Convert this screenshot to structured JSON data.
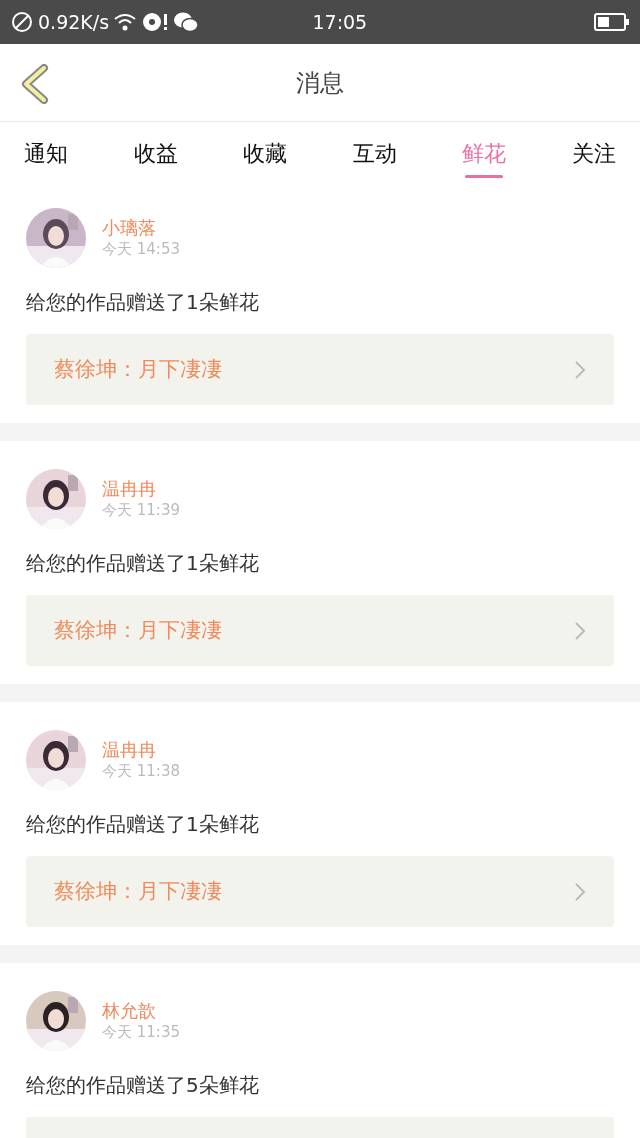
{
  "status_bar": {
    "net_speed": "0.92K/s",
    "time": "17:05"
  },
  "header": {
    "title": "消息"
  },
  "tabs": [
    {
      "label": "通知",
      "selected": false
    },
    {
      "label": "收益",
      "selected": false
    },
    {
      "label": "收藏",
      "selected": false
    },
    {
      "label": "互动",
      "selected": false
    },
    {
      "label": "鲜花",
      "selected": true
    },
    {
      "label": "关注",
      "selected": false
    }
  ],
  "messages": [
    {
      "name": "小璃落",
      "time": "今天 14:53",
      "text": "给您的作品赠送了1朵鲜花",
      "quote": "蔡徐坤：月下凄凄"
    },
    {
      "name": "温冉冉",
      "time": "今天 11:39",
      "text": "给您的作品赠送了1朵鲜花",
      "quote": "蔡徐坤：月下凄凄"
    },
    {
      "name": "温冉冉",
      "time": "今天 11:38",
      "text": "给您的作品赠送了1朵鲜花",
      "quote": "蔡徐坤：月下凄凄"
    },
    {
      "name": "林允歆",
      "time": "今天 11:35",
      "text": "给您的作品赠送了5朵鲜花"
    }
  ]
}
